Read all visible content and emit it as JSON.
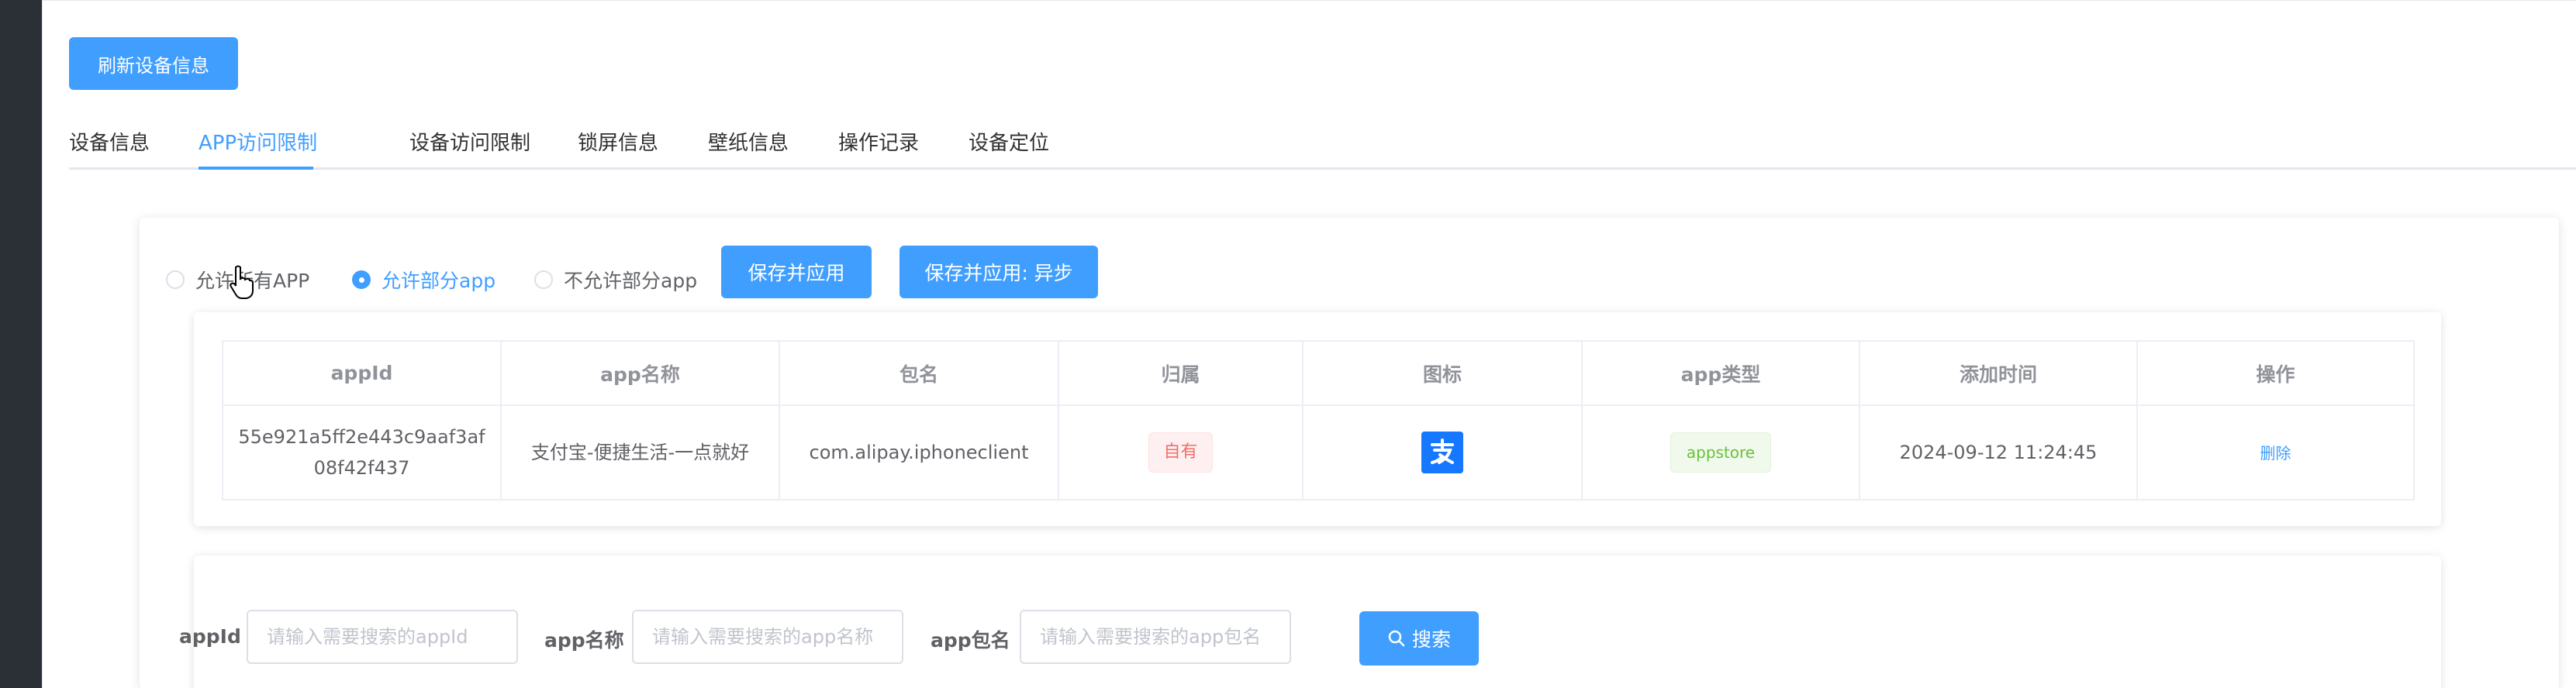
{
  "toolbar": {
    "refresh_label": "刷新设备信息"
  },
  "tabs": [
    {
      "label": "设备信息"
    },
    {
      "label": "APP访问限制"
    },
    {
      "label": "设备访问限制"
    },
    {
      "label": "锁屏信息"
    },
    {
      "label": "壁纸信息"
    },
    {
      "label": "操作记录"
    },
    {
      "label": "设备定位"
    }
  ],
  "mode": {
    "options": [
      "允许所有APP",
      "允许部分app",
      "不允许部分app"
    ],
    "selected": "允许部分app",
    "save_label": "保存并应用",
    "save_async_label": "保存并应用: 异步"
  },
  "table": {
    "columns": [
      "appId",
      "app名称",
      "包名",
      "归属",
      "图标",
      "app类型",
      "添加时间",
      "操作"
    ],
    "rows": [
      {
        "appId": "55e921a5ff2e443c9aaf3af08f42f437",
        "name": "支付宝-便捷生活-一点就好",
        "bundle": "com.alipay.iphoneclient",
        "owner": "自有",
        "icon": "alipay-icon",
        "type": "appstore",
        "added": "2024-09-12 11:24:45",
        "action": "删除"
      }
    ]
  },
  "search": {
    "appid_label": "appId",
    "appid_placeholder": "请输入需要搜索的appId",
    "name_label": "app名称",
    "name_placeholder": "请输入需要搜索的app名称",
    "bundle_label": "app包名",
    "bundle_placeholder": "请输入需要搜索的app包名",
    "button_label": "搜索"
  },
  "colors": {
    "primary": "#409eff",
    "alipay": "#1677ff"
  }
}
